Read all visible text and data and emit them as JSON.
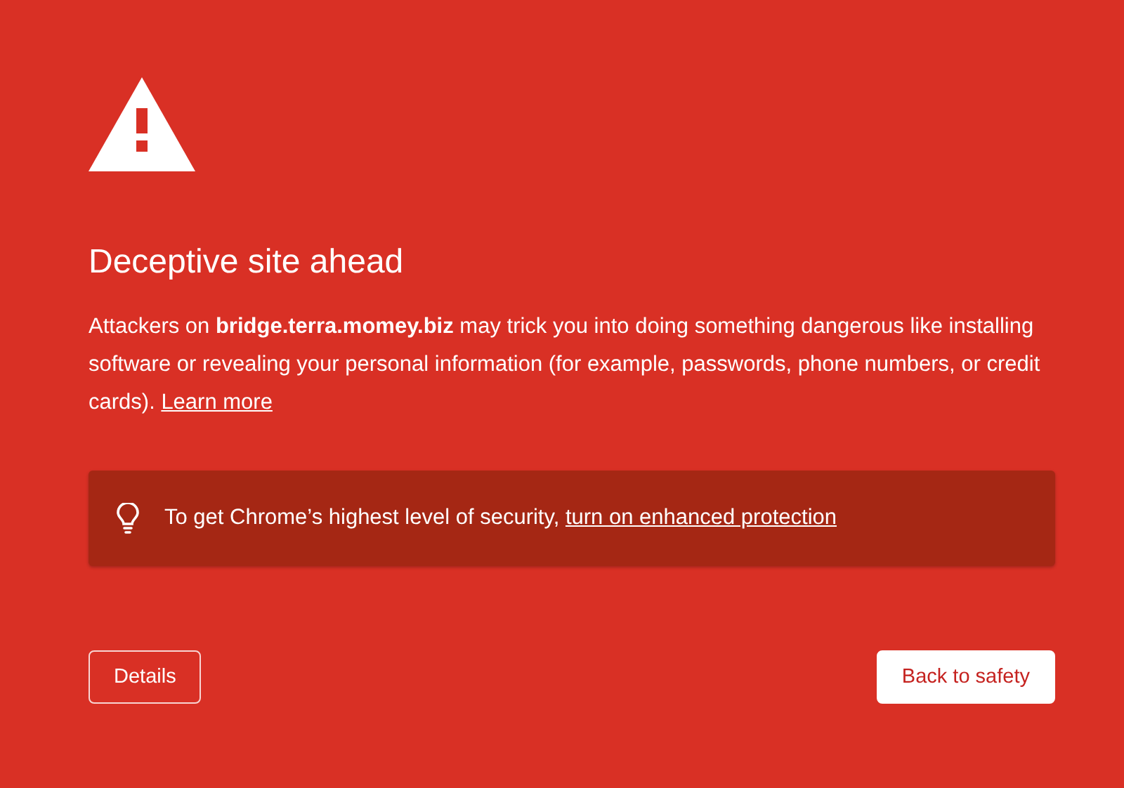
{
  "heading": "Deceptive site ahead",
  "message": {
    "text": "Attackers on **bridge.terra.momey.biz** may trick you into doing something dangerous like installing software or revealing your personal information (for example, passwords, phone numbers, or credit cards).",
    "link": "Learn more"
  },
  "banner": {
    "text": "To get Chrome’s highest level of security,",
    "link": "turn on enhanced protection"
  },
  "buttons": [
    {
      "label": "Details",
      "kind": "secondary"
    },
    {
      "label": "Back to safety",
      "kind": "primary"
    }
  ]
}
